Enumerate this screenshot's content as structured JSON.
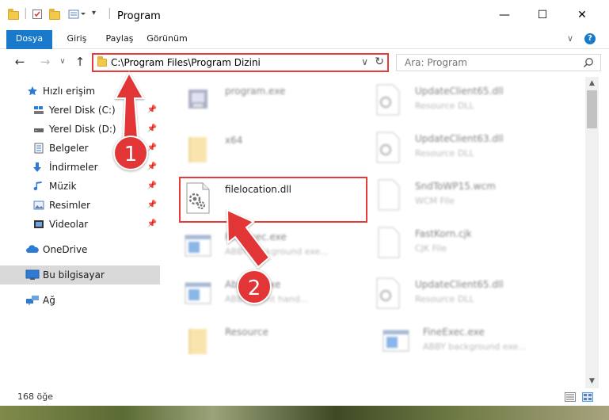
{
  "window": {
    "title": "Program",
    "controls": {
      "minimize": "—",
      "maximize": "☐",
      "close": "✕"
    }
  },
  "ribbon": {
    "tabs": [
      {
        "label": "Dosya",
        "active": true
      },
      {
        "label": "Giriş"
      },
      {
        "label": "Paylaş"
      },
      {
        "label": "Görünüm"
      }
    ],
    "accent_color": "#1979ca"
  },
  "navigation": {
    "back": "←",
    "forward": "→",
    "recent": "∨",
    "up": "↑",
    "address": "C:\\Program Files\\Program Dizini",
    "refresh": "↻",
    "search_placeholder": "Ara: Program"
  },
  "sidebar": {
    "items": [
      {
        "label": "Hızlı erişim",
        "icon": "star-icon"
      },
      {
        "label": "Yerel Disk (C:)",
        "icon": "drive-icon",
        "pinned": true
      },
      {
        "label": "Yerel Disk (D:)",
        "icon": "drive-icon",
        "pinned": true
      },
      {
        "label": "Belgeler",
        "icon": "documents-icon",
        "pinned": true
      },
      {
        "label": "İndirmeler",
        "icon": "download-icon",
        "pinned": true
      },
      {
        "label": "Müzik",
        "icon": "music-icon",
        "pinned": true
      },
      {
        "label": "Resimler",
        "icon": "pictures-icon",
        "pinned": true
      },
      {
        "label": "Videolar",
        "icon": "videos-icon",
        "pinned": true
      },
      {
        "label": "OneDrive",
        "icon": "cloud-icon"
      },
      {
        "label": "Bu bilgisayar",
        "icon": "computer-icon",
        "selected": true
      },
      {
        "label": "Ağ",
        "icon": "network-icon"
      }
    ],
    "pin_glyph": "📌"
  },
  "files": {
    "left": [
      {
        "name": "program.exe",
        "desc": "",
        "icon": "exe-icon"
      },
      {
        "name": "x64",
        "desc": "",
        "icon": "folder-icon"
      },
      {
        "name": "filelocation.dll",
        "desc": "",
        "icon": "dll-icon"
      },
      {
        "name": "FineExec.exe",
        "desc": "ABBY background exe...",
        "icon": "app-window-icon"
      },
      {
        "name": "AbbyEx.exe",
        "desc": "ABBY event hand...",
        "icon": "app-window-icon"
      },
      {
        "name": "Resource",
        "desc": "",
        "icon": "folder-icon"
      }
    ],
    "right": [
      {
        "name": "UpdateClient65.dll",
        "desc": "Resource DLL",
        "icon": "dll-icon"
      },
      {
        "name": "UpdateClient63.dll",
        "desc": "Resource DLL",
        "icon": "dll-icon"
      },
      {
        "name": "SndToWP15.wcm",
        "desc": "WCM File",
        "icon": "blank-file-icon"
      },
      {
        "name": "FastKorn.cjk",
        "desc": "CJK File",
        "icon": "blank-file-icon"
      },
      {
        "name": "UpdateClient65.dll",
        "desc": "Resource DLL",
        "icon": "dll-icon"
      },
      {
        "name": "FineExec.exe",
        "desc": "ABBY background exe...",
        "icon": "app-window-icon"
      }
    ]
  },
  "status": {
    "item_count": "168 öğe"
  },
  "annotations": {
    "step1": "1",
    "step2": "2",
    "color": "#e23636"
  }
}
